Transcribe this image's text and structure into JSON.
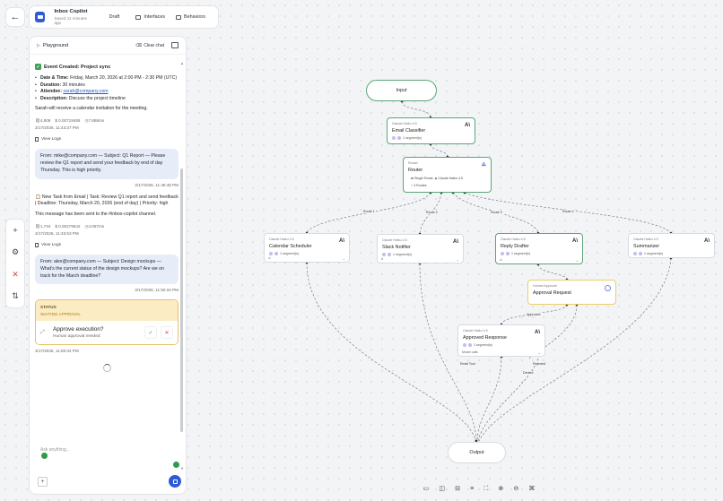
{
  "header": {
    "title": "Inbox Copilot",
    "saved": "Saved 11 minutes ago",
    "status": "Draft",
    "tabs": [
      "Interfaces",
      "Behaviors"
    ]
  },
  "playground": {
    "title": "Playground",
    "clear_label": "Clear chat",
    "event": {
      "heading": "Event Created: Project sync",
      "date_label": "Date & Time:",
      "date_value": "Friday, March 20, 2026 at 2:00 PM - 2:30 PM (UTC)",
      "duration_label": "Duration:",
      "duration_value": "30 minutes",
      "attendee_label": "Attendee:",
      "attendee_value": "sarah@company.com",
      "description_label": "Description:",
      "description_value": "Discuss the project timeline",
      "followup": "Sarah will receive a calendar invitation for the meeting.",
      "tokens": "4,809",
      "cost": "$ 0.00719455",
      "latency": "7.888ms",
      "timestamp": "3/17/2026, 11:43:37 PM",
      "logs_label": "View Logs"
    },
    "user_msg_1": {
      "text": "From: mike@company.com — Subject: Q1 Report — Please review the Q1 report and send your feedback by end of day Thursday. This is high priority.",
      "time": "3/17/2026, 11:45:48 PM"
    },
    "task": {
      "text": "New Task from Email | Task: Review Q1 report and send feedback | Deadline: Thursday, March 20, 2026 (end of day) | Priority: high",
      "sent": "This message has been sent to the #inbox-copilot channel.",
      "tokens": "1,734",
      "cost": "$ 0.00279542",
      "latency": "4.057ms",
      "timestamp": "3/17/2026, 11:45:53 PM",
      "logs_label": "View Logs"
    },
    "user_msg_2": {
      "text": "From: alex@company.com — Subject: Design mockups — What's the current status of the design mockups? Are we on track for the March deadline?",
      "time": "3/17/2026, 11:50:24 PM"
    },
    "approval": {
      "status_label": "STATUS",
      "status_value": "WAITING APPROVAL",
      "title": "Approve execution?",
      "subtitle": "Human approval needed",
      "timestamp": "3/17/2026, 11:50:34 PM"
    },
    "composer_placeholder": "Ask anything..."
  },
  "graph": {
    "input_label": "Input",
    "output_label": "Output",
    "email_classifier": {
      "model": "Claude Haiku 4.5",
      "name": "Email Classifier",
      "segments": "1 segment(s)"
    },
    "router": {
      "model": "Router",
      "name": "Router",
      "mode": "Single Route",
      "model2": "Claude Haiku 4.5",
      "routes": "4 Routes"
    },
    "calendar": {
      "model": "Claude Haiku 4.5",
      "name": "Calendar Scheduler",
      "segments": "1 segment(s)"
    },
    "slack": {
      "model": "Claude Haiku 4.5",
      "name": "Slack Notifier",
      "segments": "1 segment(s)"
    },
    "reply": {
      "model": "Claude Haiku 4.5",
      "name": "Reply Drafter",
      "segments": "1 segment(s)"
    },
    "summarizer": {
      "model": "Claude Haiku 4.5",
      "name": "Summarizer",
      "segments": "1 segment(s)"
    },
    "approval_req": {
      "model": "Human Approval",
      "name": "Approval Request"
    },
    "approved": {
      "model": "Claude Haiku 4.5",
      "name": "Approved Response",
      "segments": "1 segment(s)",
      "foot": "Model calls"
    },
    "edge_labels": [
      "Route 1",
      "Route 2",
      "Route 3",
      "Route 4",
      "Approved",
      "Email Tool",
      "Rejected",
      "Denied"
    ]
  },
  "colors": {
    "accent": "#2f5bd6",
    "success": "#2f9a4a",
    "danger": "#d64545",
    "waiting": "#fbecc4"
  }
}
